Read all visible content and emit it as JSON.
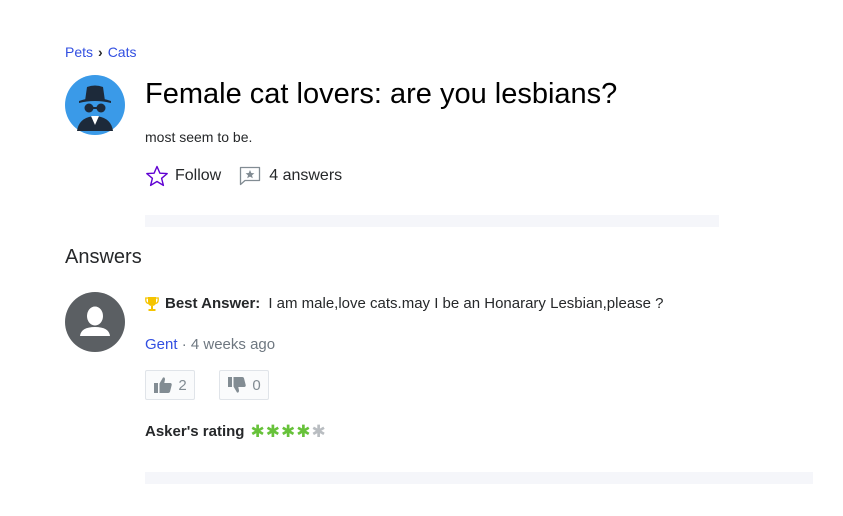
{
  "breadcrumb": {
    "parent": "Pets",
    "current": "Cats"
  },
  "question": {
    "title": "Female cat lovers: are you lesbians?",
    "body": "most seem to be.",
    "follow_label": "Follow",
    "answers_count_label": "4 answers"
  },
  "answers_heading": "Answers",
  "answer": {
    "best_label": "Best Answer:",
    "text": "I am male,love cats.may I be an Honarary Lesbian,please ?",
    "author": "Gent",
    "separator": "·",
    "time": "4 weeks ago",
    "upvotes": "2",
    "downvotes": "0"
  },
  "rating": {
    "label": "Asker's rating",
    "value": 4,
    "max": 5
  },
  "colors": {
    "link": "#324fe1",
    "follow_star": "#6001d2",
    "trophy": "#f5c400",
    "rating_green": "#67c23a",
    "avatar_blue": "#3a9ae8",
    "avatar_gray": "#5b5f63"
  }
}
